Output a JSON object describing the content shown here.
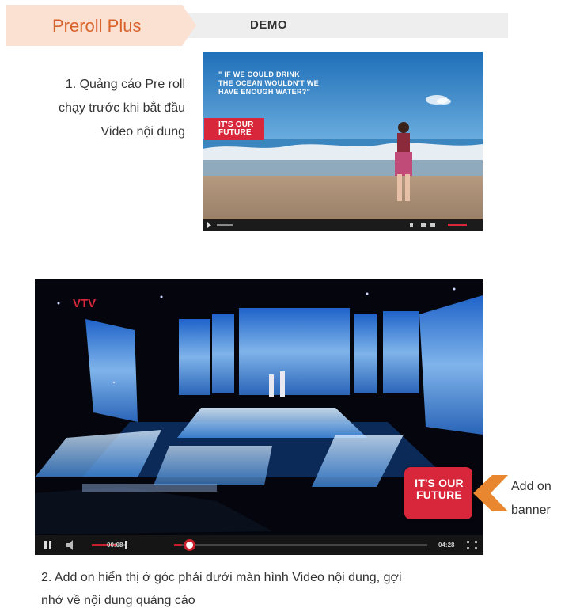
{
  "header": {
    "tab_title": "Preroll Plus",
    "section_label": "DEMO"
  },
  "step1": {
    "line1": "1. Quảng cáo Pre roll",
    "line2": "chạy trước khi bắt đầu",
    "line3": "Video nội dung"
  },
  "video1": {
    "quote_line1": "\" IF WE COULD DRINK",
    "quote_line2": "THE OCEAN WOULDN'T WE",
    "quote_line3": "HAVE ENOUGH WATER?\"",
    "brand_line1": "IT'S OUR",
    "brand_line2": "FUTURE"
  },
  "video2": {
    "channel_logo": "VTV",
    "brand_line1": "IT'S OUR",
    "brand_line2": "FUTURE",
    "time_elapsed": "00:08",
    "time_total": "04:28",
    "progress": 0.03,
    "volume": 0.7
  },
  "addon": {
    "line1": "Add on",
    "line2": "banner"
  },
  "step2": {
    "line1": "2. Add on hiển thị ở góc phải dưới màn hình Video nội dung, gợi",
    "line2": "nhớ về nội dung quảng cáo"
  },
  "colors": {
    "tab_bg": "#fbe1d2",
    "accent": "#d9622a",
    "arrow": "#e8872f",
    "brand_red": "#d8263a"
  }
}
